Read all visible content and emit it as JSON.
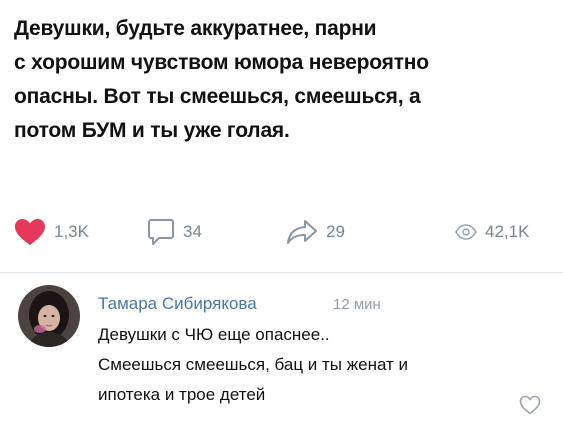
{
  "post": {
    "text": "Девушки, будьте аккуратнее, парни\nс хорошим чувством юмора невероятно\nопасны. Вот ты смеешься, смеешься, а\nпотом БУМ и ты уже голая."
  },
  "actions": {
    "likes": "1,3K",
    "comments": "34",
    "shares": "29",
    "views": "42,1K"
  },
  "comment": {
    "author": "Тамара Сибирякова",
    "time": "12 мин",
    "text": "Девушки с ЧЮ еще опаснее..\nСмеешься смеешься, бац и ты женат и\nипотека и трое детей"
  },
  "colors": {
    "like": "#e6385a",
    "icon": "#8a96a3",
    "link": "#4a76a8"
  }
}
